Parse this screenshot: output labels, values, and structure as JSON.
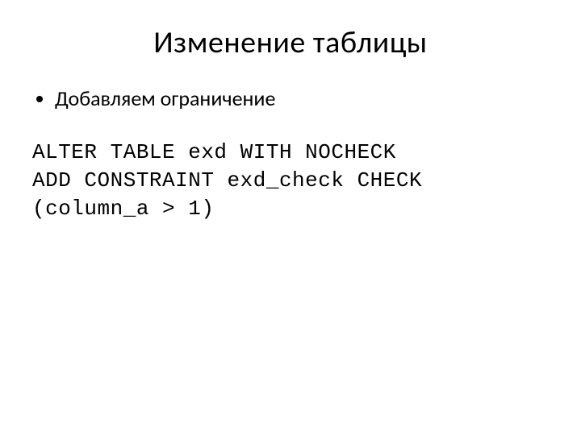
{
  "title": "Изменение таблицы",
  "bullet1": "Добавляем ограничение",
  "code_line1": "ALTER TABLE exd WITH NOCHECK",
  "code_line2": "ADD CONSTRAINT exd_check CHECK",
  "code_line3": "(column_a > 1)"
}
